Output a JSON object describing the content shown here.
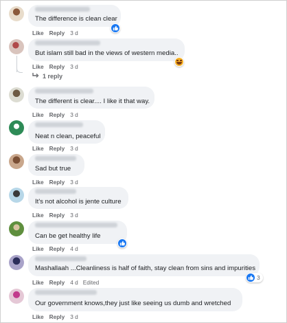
{
  "actions": {
    "like": "Like",
    "reply": "Reply",
    "edited": "Edited"
  },
  "colors": {
    "accent": "#1877f2",
    "bubble": "#f0f2f5",
    "meta": "#65676b"
  },
  "comments": [
    {
      "text": "The difference is clean clear",
      "time": "3 d",
      "reaction": "like-icon"
    },
    {
      "text": "But islam still bad in the views of western media..",
      "time": "3 d",
      "reaction": "haha-icon",
      "reply_link": "1 reply"
    },
    {
      "text": "The different is clear.... I like it that way.",
      "time": "3 d"
    },
    {
      "text": "Neat n clean, peaceful",
      "time": "3 d"
    },
    {
      "text": "Sad but true",
      "time": "3 d"
    },
    {
      "text": "It's not alcohol is jente culture",
      "time": "3 d"
    },
    {
      "text": "Can be get healthy life",
      "time": "4 d",
      "reaction": "like-icon"
    },
    {
      "text": "Mashallaah ...Cleanliness is half of faith, stay clean from sins and impurities",
      "time": "4 d",
      "reaction": "like-icon",
      "reaction_count": "3"
    },
    {
      "text": "Our government knows,they just like seeing us dumb and wretched",
      "time": "3 d"
    }
  ]
}
